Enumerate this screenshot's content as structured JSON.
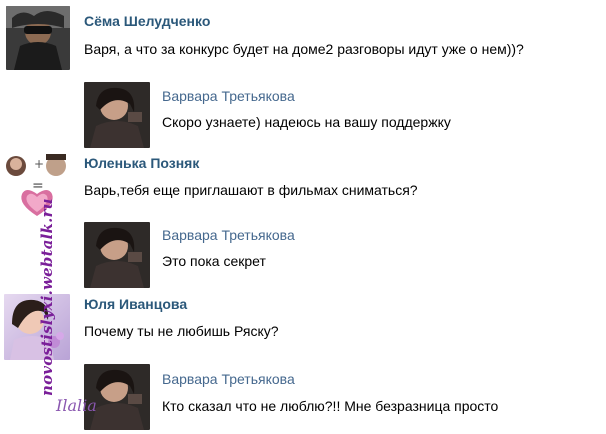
{
  "watermark": "novostislyxi.webtalk.ru",
  "signature": "Ilalia",
  "comments": [
    {
      "author": "Сёма Шелудченко",
      "text": "Варя, а что за конкурс будет на доме2 разговоры идут уже о нем))?"
    },
    {
      "author": "Варвара Третьякова",
      "text": "Скоро узнаете) надеюсь на вашу поддержку"
    },
    {
      "author": "Юленька Позняк",
      "text": "Варь,тебя еще приглашают в фильмах сниматься?"
    },
    {
      "author": "Варвара Третьякова",
      "text": "Это пока секрет"
    },
    {
      "author": "Юля Иванцова",
      "text": "Почему ты не любишь Ряску?"
    },
    {
      "author": "Варвара Третьякова",
      "text": "Кто сказал что не люблю?!! Мне безразница просто"
    }
  ]
}
